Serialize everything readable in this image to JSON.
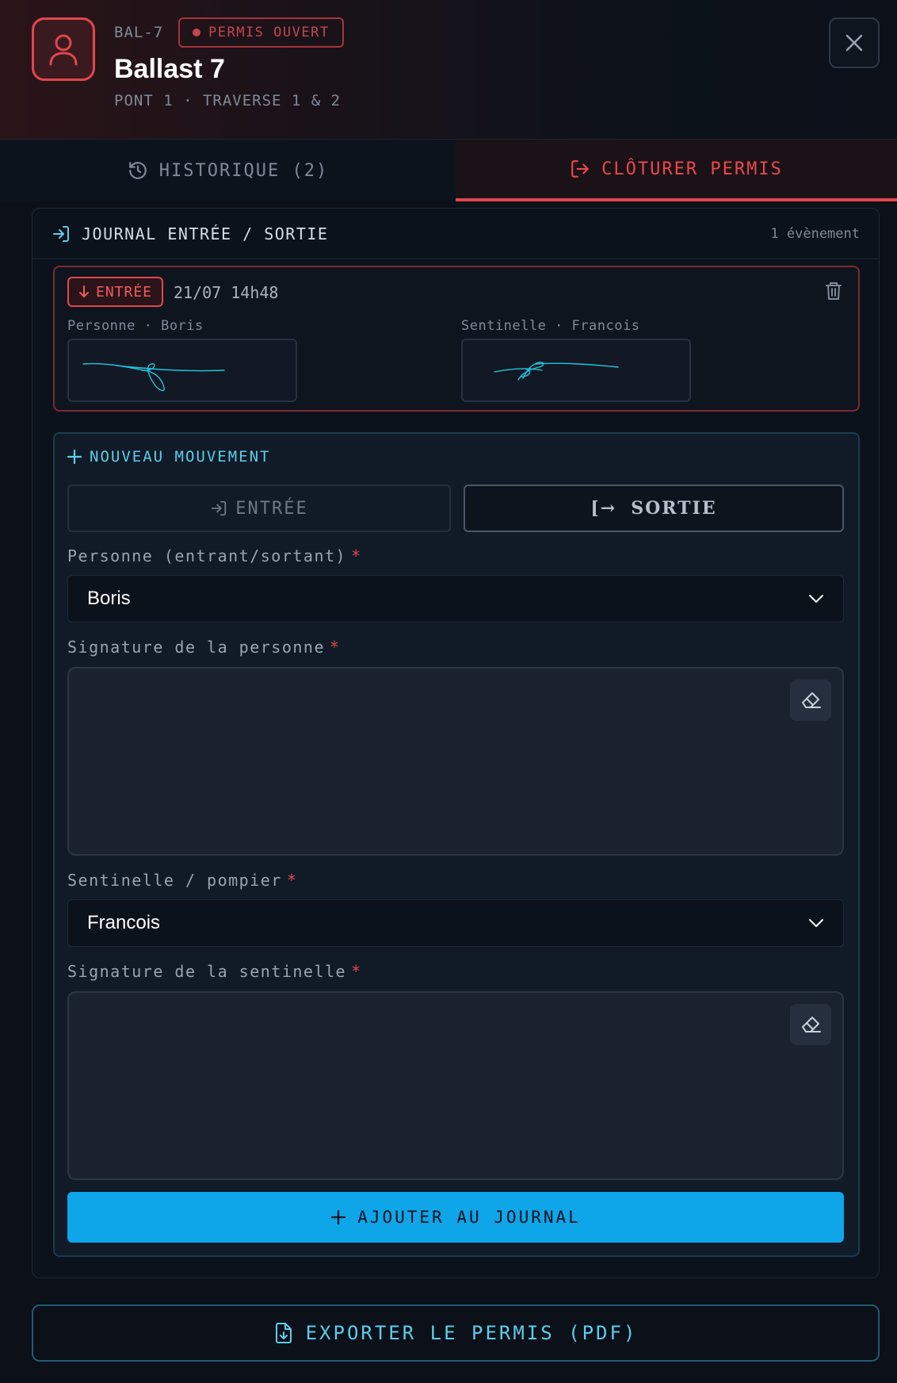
{
  "header": {
    "code": "BAL-7",
    "status": "PERMIS OUVERT",
    "title": "Ballast 7",
    "subtitle": "PONT 1 · TRAVERSE 1 & 2"
  },
  "tabs": [
    {
      "label": "HISTORIQUE (2)",
      "icon": "history-icon",
      "active": false
    },
    {
      "label": "CLÔTURER PERMIS",
      "icon": "logout-icon",
      "active": true
    }
  ],
  "log": {
    "title": "JOURNAL ENTRÉE / SORTIE",
    "count": "1 évènement",
    "events": [
      {
        "type": "ENTRÉE",
        "time": "21/07 14h48",
        "person_label": "Personne · Boris",
        "sentinel_label": "Sentinelle · Francois"
      }
    ]
  },
  "new_movement": {
    "title": "NOUVEAU MOUVEMENT",
    "toggle_entry": "ENTRÉE",
    "toggle_exit": "SORTIE",
    "toggle_exit_icon": "[→",
    "person_label": "Personne (entrant/sortant)",
    "person_value": "Boris",
    "person_sig_label": "Signature de la personne",
    "sentinel_label": "Sentinelle / pompier",
    "sentinel_value": "Francois",
    "sentinel_sig_label": "Signature de la sentinelle",
    "required_mark": "*",
    "add_button": "AJOUTER AU JOURNAL"
  },
  "export_button": "EXPORTER LE PERMIS (PDF)",
  "colors": {
    "accent_red": "#e0474c",
    "accent_cyan": "#5ecdea",
    "primary_button": "#0ea5e9",
    "background": "#0b1019"
  }
}
